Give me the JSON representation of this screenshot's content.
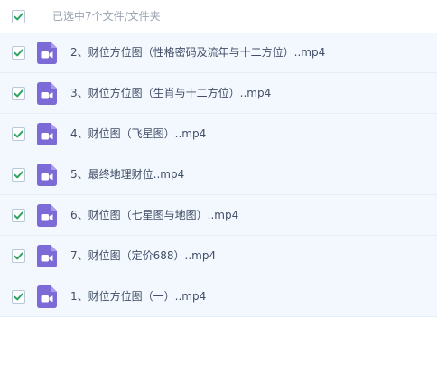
{
  "header": {
    "summary": "已选中7个文件/文件夹",
    "select_all_checked": true
  },
  "files": [
    {
      "name": "2、财位方位图（性格密码及流年与十二方位）..mp4",
      "checked": true,
      "icon": "video-file-icon"
    },
    {
      "name": "3、财位方位图（生肖与十二方位）..mp4",
      "checked": true,
      "icon": "video-file-icon"
    },
    {
      "name": "4、财位图（飞星图）..mp4",
      "checked": true,
      "icon": "video-file-icon"
    },
    {
      "name": "5、最终地理财位..mp4",
      "checked": true,
      "icon": "video-file-icon"
    },
    {
      "name": "6、财位图（七星图与地图）..mp4",
      "checked": true,
      "icon": "video-file-icon"
    },
    {
      "name": "7、财位图（定价688）..mp4",
      "checked": true,
      "icon": "video-file-icon"
    },
    {
      "name": "1、财位方位图（一）..mp4",
      "checked": true,
      "icon": "video-file-icon"
    }
  ],
  "colors": {
    "checkmark": "#2fa45f",
    "video_icon": "#7c6bd6",
    "row_background": "#f2f8fd"
  }
}
